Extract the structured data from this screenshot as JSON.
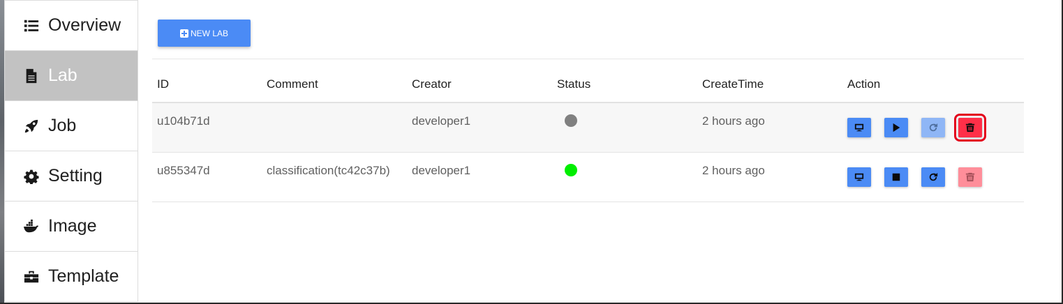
{
  "sidebar": {
    "items": [
      {
        "label": "Overview",
        "icon": "list-icon",
        "active": false
      },
      {
        "label": "Lab",
        "icon": "file-icon",
        "active": true
      },
      {
        "label": "Job",
        "icon": "rocket-icon",
        "active": false
      },
      {
        "label": "Setting",
        "icon": "gear-icon",
        "active": false
      },
      {
        "label": "Image",
        "icon": "docker-icon",
        "active": false
      },
      {
        "label": "Template",
        "icon": "toolbox-icon",
        "active": false
      }
    ]
  },
  "toolbar": {
    "new_lab_label": "NEW LAB"
  },
  "table": {
    "headers": [
      "ID",
      "Comment",
      "Creator",
      "Status",
      "CreateTime",
      "Action"
    ],
    "rows": [
      {
        "id": "u104b71d",
        "comment": "",
        "creator": "developer1",
        "status": "stopped",
        "status_color": "#808080",
        "create_time": "2 hours ago",
        "actions": [
          "desktop-icon",
          "play-icon",
          "restart-icon",
          "trash-icon"
        ]
      },
      {
        "id": "u855347d",
        "comment": "classification(tc42c37b)",
        "creator": "developer1",
        "status": "running",
        "status_color": "#00ee00",
        "create_time": "2 hours ago",
        "actions": [
          "desktop-icon",
          "stop-icon",
          "restart-icon",
          "trash-icon"
        ]
      }
    ]
  },
  "colors": {
    "primary": "#4b8bf5",
    "danger": "#ff2f48",
    "active_nav": "#c2c2c2"
  }
}
